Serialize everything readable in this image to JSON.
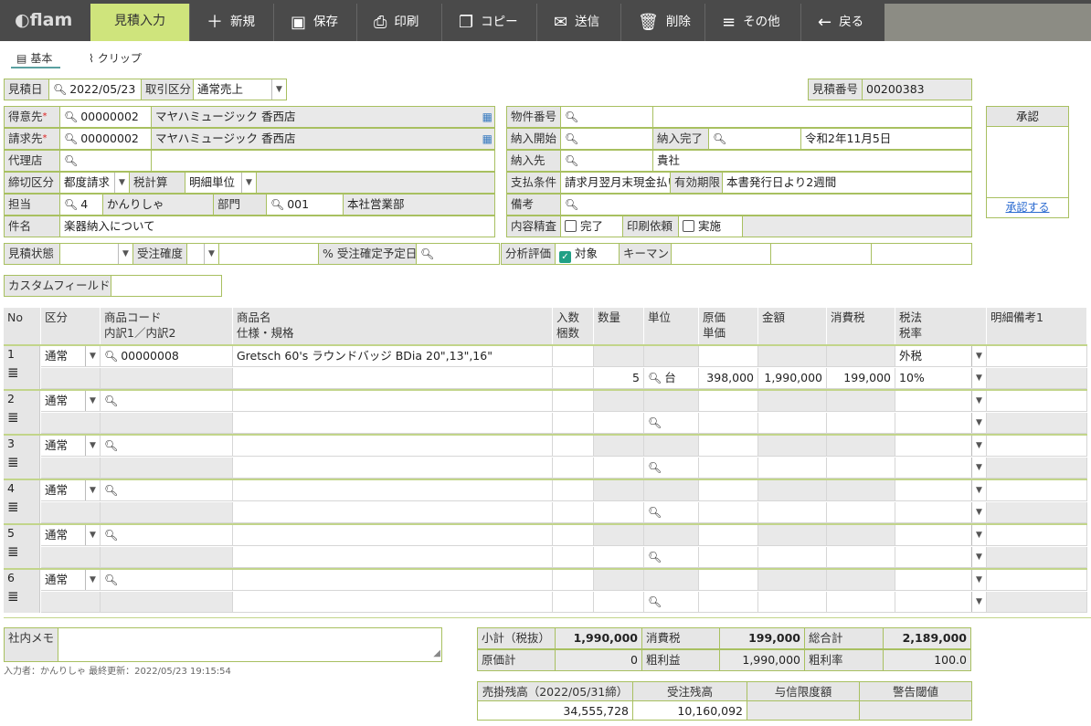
{
  "app": {
    "logo": "flam",
    "active_tab": "見積入力"
  },
  "toolbar": [
    {
      "icon": "plus-icon",
      "glyph": "＋",
      "label": "新規"
    },
    {
      "icon": "save-icon",
      "glyph": "▣",
      "label": "保存"
    },
    {
      "icon": "print-icon",
      "glyph": "⎙",
      "label": "印刷"
    },
    {
      "icon": "copy-icon",
      "glyph": "❐",
      "label": "コピー"
    },
    {
      "icon": "mail-icon",
      "glyph": "✉",
      "label": "送信"
    },
    {
      "icon": "trash-icon",
      "glyph": "🗑",
      "label": "削除"
    },
    {
      "icon": "menu-icon",
      "glyph": "≡",
      "label": "その他"
    },
    {
      "icon": "back-icon",
      "glyph": "←",
      "label": "戻る"
    }
  ],
  "subtabs": [
    {
      "icon": "doc-icon",
      "glyph": "▤",
      "label": "基本"
    },
    {
      "icon": "clip-icon",
      "glyph": "⌇",
      "label": "クリップ"
    }
  ],
  "header": {
    "date_label": "見積日",
    "date": "2022/05/23",
    "trade_label": "取引区分",
    "trade": "通常売上",
    "estno_label": "見積番号",
    "estno": "00200383",
    "customer_label": "得意先",
    "customer_code": "00000002",
    "customer_name": "マヤハミュージック 香西店",
    "billing_label": "請求先",
    "billing_code": "00000002",
    "billing_name": "マヤハミュージック 香西店",
    "agent_label": "代理店",
    "cutoff_label": "締切区分",
    "cutoff": "都度請求",
    "tax_calc_label": "税計算",
    "tax_calc": "明細単位",
    "staff_label": "担当",
    "staff_code": "4",
    "staff_name": "かんりしゃ",
    "dept_label": "部門",
    "dept_code": "001",
    "dept_name": "本社営業部",
    "subject_label": "件名",
    "subject": "楽器納入について",
    "property_label": "物件番号",
    "deliv_start_label": "納入開始",
    "deliv_end_label": "納入完了",
    "deliv_end": "令和2年11月5日",
    "deliv_to_label": "納入先",
    "deliv_to": "貴社",
    "payment_label": "支払条件",
    "payment": "請求月翌月末現金払い",
    "valid_label": "有効期限",
    "valid": "本書発行日より2週間",
    "remarks_label": "備考",
    "review_label": "内容精査",
    "review_chk": "完了",
    "print_req_label": "印刷依頼",
    "print_req_chk": "実施",
    "approve_label": "承認",
    "approve_link": "承認する",
    "est_status_label": "見積状態",
    "order_prob_label": "受注確度",
    "percent": "%",
    "order_date_label": "受注確定予定日",
    "analysis_label": "分析評価",
    "analysis_chk": "対象",
    "keyman_label": "キーマン",
    "custom_label": "カスタムフィールド"
  },
  "grid": {
    "headers": {
      "no": "No",
      "kubun": "区分",
      "code": "商品コード",
      "code2": "内訳1／内訳2",
      "name": "商品名",
      "name2": "仕様・規格",
      "irisu": "入数",
      "irisu2": "梱数",
      "qty": "数量",
      "unit": "単位",
      "cost": "原価",
      "cost2": "単価",
      "amount": "金額",
      "tax": "消費税",
      "taxlaw": "税法",
      "taxrate": "税率",
      "memo": "明細備考1"
    },
    "rows": [
      {
        "no": "1",
        "kubun": "通常",
        "code": "00000008",
        "name": "Gretsch 60's ラウンドバッジ BDia 20\",13\",16\"",
        "qty": "5",
        "unit": "台",
        "price": "398,000",
        "amount": "1,990,000",
        "tax": "199,000",
        "taxlaw": "外税",
        "taxrate": "10%"
      },
      {
        "no": "2",
        "kubun": "通常",
        "code": "",
        "name": "",
        "qty": "",
        "unit": "",
        "price": "",
        "amount": "",
        "tax": "",
        "taxlaw": "",
        "taxrate": ""
      },
      {
        "no": "3",
        "kubun": "通常",
        "code": "",
        "name": "",
        "qty": "",
        "unit": "",
        "price": "",
        "amount": "",
        "tax": "",
        "taxlaw": "",
        "taxrate": ""
      },
      {
        "no": "4",
        "kubun": "通常",
        "code": "",
        "name": "",
        "qty": "",
        "unit": "",
        "price": "",
        "amount": "",
        "tax": "",
        "taxlaw": "",
        "taxrate": ""
      },
      {
        "no": "5",
        "kubun": "通常",
        "code": "",
        "name": "",
        "qty": "",
        "unit": "",
        "price": "",
        "amount": "",
        "tax": "",
        "taxlaw": "",
        "taxrate": ""
      },
      {
        "no": "6",
        "kubun": "通常",
        "code": "",
        "name": "",
        "qty": "",
        "unit": "",
        "price": "",
        "amount": "",
        "tax": "",
        "taxlaw": "",
        "taxrate": ""
      }
    ]
  },
  "footer": {
    "memo_label": "社内メモ",
    "entry_info": "入力者：かんりしゃ 最終更新：2022/05/23 19:15:54",
    "subtotal_label": "小計（税抜）",
    "subtotal": "1,990,000",
    "tax_label": "消費税",
    "tax": "199,000",
    "total_label": "総合計",
    "total": "2,189,000",
    "cost_label": "原価計",
    "cost": "0",
    "profit_label": "粗利益",
    "profit": "1,990,000",
    "margin_label": "粗利率",
    "margin": "100.0",
    "ar_label": "売掛残高（2022/05/31締）",
    "ar": "34,555,728",
    "order_bal_label": "受注残高",
    "order_bal": "10,160,092",
    "credit_label": "与信限度額",
    "warn_label": "警告閾値"
  }
}
